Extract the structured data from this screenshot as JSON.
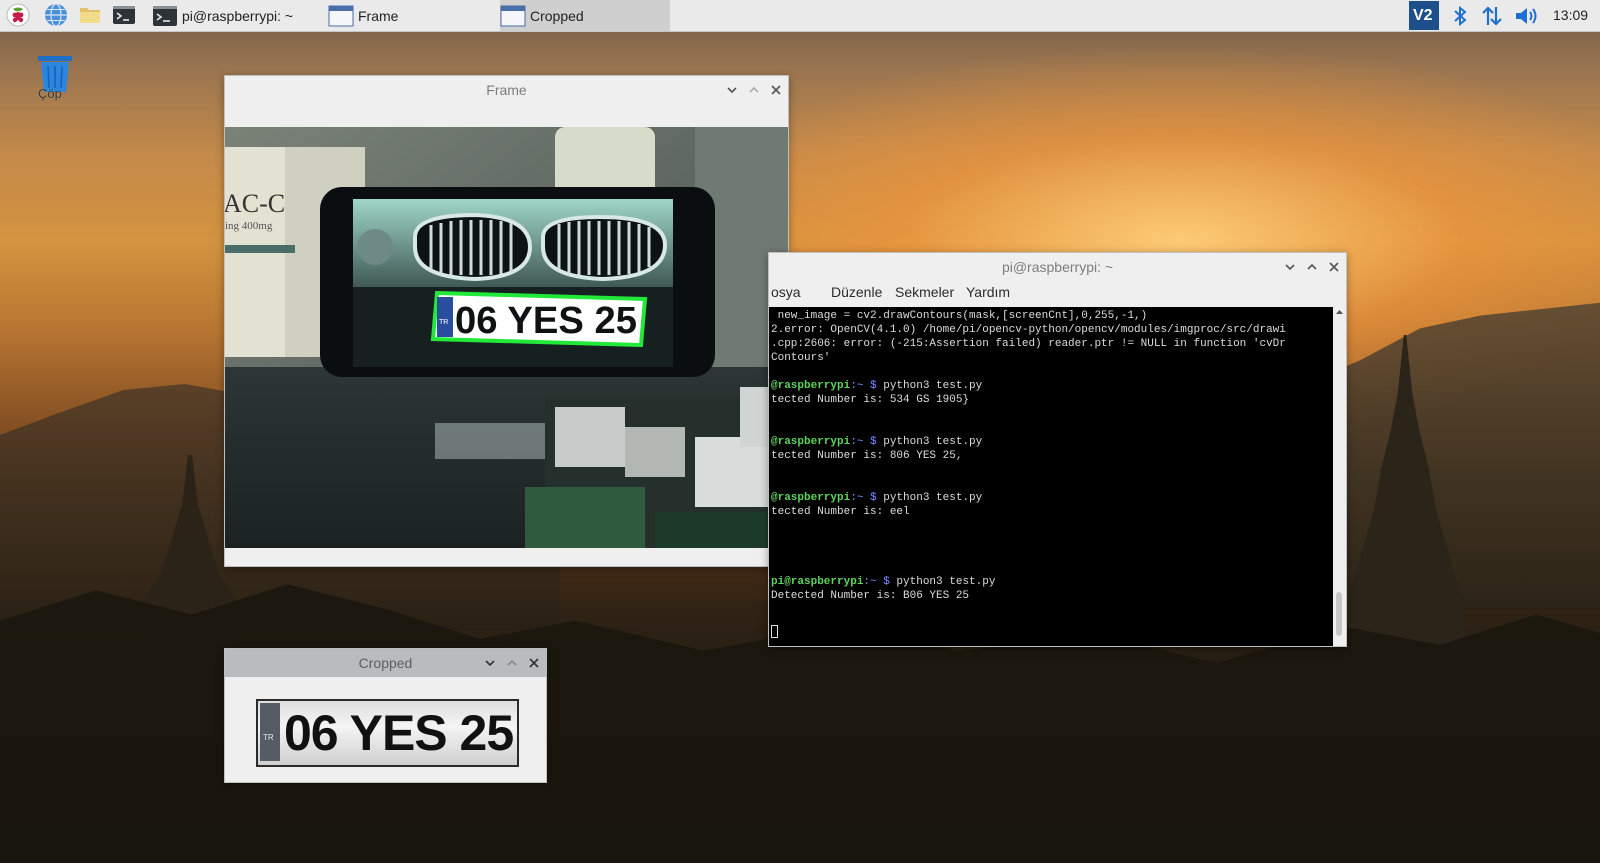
{
  "taskbar": {
    "tasks": [
      {
        "label": "pi@raspberrypi: ~"
      },
      {
        "label": "Frame"
      },
      {
        "label": "Cropped"
      }
    ],
    "clock": "13:09",
    "vnc_label": "V2"
  },
  "desktop": {
    "trash_label": "Çöp"
  },
  "frame_window": {
    "title": "Frame",
    "plate_text": "06 YES 25",
    "plate_country": "TR",
    "box_text": "AC-C",
    "box_sub": "ing 400mg"
  },
  "terminal_window": {
    "title": "pi@raspberrypi: ~",
    "menu": [
      "osya",
      "Düzenle",
      "Sekmeler",
      "Yardım"
    ],
    "lines": [
      {
        "plain": " new_image = cv2.drawContours(mask,[screenCnt],0,255,-1,)"
      },
      {
        "plain": "2.error: OpenCV(4.1.0) /home/pi/opencv-python/opencv/modules/imgproc/src/drawi"
      },
      {
        "plain": ".cpp:2606: error: (-215:Assertion failed) reader.ptr != NULL in function 'cvDr"
      },
      {
        "plain": "Contours'"
      },
      {
        "plain": ""
      },
      {
        "user": "@raspberrypi",
        "sign": ":~ $",
        "cmd": " python3 test.py"
      },
      {
        "plain": "tected Number is: 534 GS 1905}"
      },
      {
        "plain": ""
      },
      {
        "plain": ""
      },
      {
        "user": "@raspberrypi",
        "sign": ":~ $",
        "cmd": " python3 test.py"
      },
      {
        "plain": "tected Number is: 806 YES 25,"
      },
      {
        "plain": ""
      },
      {
        "plain": ""
      },
      {
        "user": "@raspberrypi",
        "sign": ":~ $",
        "cmd": " python3 test.py"
      },
      {
        "plain": "tected Number is: eel"
      },
      {
        "plain": ""
      },
      {
        "plain": ""
      },
      {
        "plain": ""
      },
      {
        "plain": ""
      },
      {
        "user": "pi@raspberrypi",
        "sign": ":~ $",
        "cmd": " python3 test.py"
      },
      {
        "plain": "Detected Number is: B06 YES 25"
      }
    ]
  },
  "cropped_window": {
    "title": "Cropped",
    "plate_text": "06 YES 25",
    "plate_country": "TR"
  }
}
